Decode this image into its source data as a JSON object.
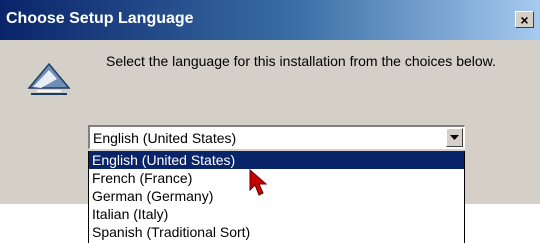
{
  "window": {
    "title": "Choose Setup Language",
    "close_label": "×"
  },
  "main": {
    "message": "Select the language for this installation from the choices below."
  },
  "language_select": {
    "value": "English (United States)",
    "options": [
      {
        "label": "English (United States)",
        "selected": true
      },
      {
        "label": "French (France)"
      },
      {
        "label": "German (Germany)"
      },
      {
        "label": "Italian (Italy)"
      },
      {
        "label": "Spanish (Traditional Sort)"
      }
    ]
  },
  "colors": {
    "highlight": "#0a246a",
    "dialog_face": "#d4d0c8",
    "cursor": "#cc0000"
  },
  "icons": [
    "setup-icon",
    "close-icon",
    "dropdown-arrow-icon",
    "mouse-cursor-icon"
  ]
}
